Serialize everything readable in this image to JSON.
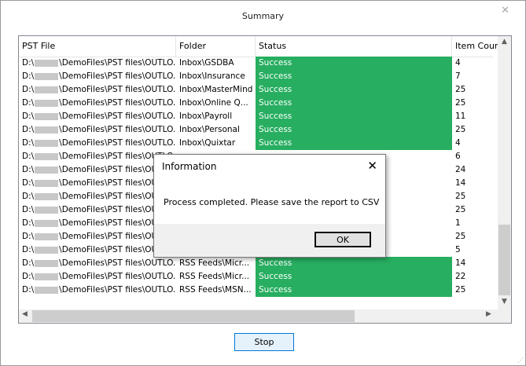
{
  "window": {
    "title": "Summary",
    "close_glyph": "✕"
  },
  "grid": {
    "columns": [
      "PST File",
      "Folder",
      "Status",
      "Item Count"
    ],
    "path_prefix": "D:\\",
    "path_suffix": "\\DemoFiles\\PST files\\OUTLO...",
    "rows": [
      {
        "folder": "Inbox\\GSDBA",
        "status": "Success",
        "count": "4"
      },
      {
        "folder": "Inbox\\Insurance",
        "status": "Success",
        "count": "7"
      },
      {
        "folder": "Inbox\\MasterMind",
        "status": "Success",
        "count": "25"
      },
      {
        "folder": "Inbox\\Online Q...",
        "status": "Success",
        "count": "25"
      },
      {
        "folder": "Inbox\\Payroll",
        "status": "Success",
        "count": "11"
      },
      {
        "folder": "Inbox\\Personal",
        "status": "Success",
        "count": "25"
      },
      {
        "folder": "Inbox\\Quixtar",
        "status": "Success",
        "count": "4"
      },
      {
        "folder": "",
        "status": "",
        "count": "6"
      },
      {
        "folder": "",
        "status": "",
        "count": "24"
      },
      {
        "folder": "",
        "status": "",
        "count": "14"
      },
      {
        "folder": "",
        "status": "",
        "count": "25"
      },
      {
        "folder": "",
        "status": "",
        "count": "25"
      },
      {
        "folder": "",
        "status": "",
        "count": "1"
      },
      {
        "folder": "",
        "status": "",
        "count": "25"
      },
      {
        "folder": "",
        "status": "",
        "count": "5"
      },
      {
        "folder": "RSS Feeds\\Micr...",
        "status": "Success",
        "count": "14"
      },
      {
        "folder": "RSS Feeds\\Micr...",
        "status": "Success",
        "count": "22"
      },
      {
        "folder": "RSS Feeds\\MSN...",
        "status": "Success",
        "count": "25"
      }
    ],
    "status_color": "#27ae60"
  },
  "dialog": {
    "title": "Information",
    "message": "Process completed. Please save the report to CSV",
    "ok_label": "OK",
    "close_glyph": "✕"
  },
  "buttons": {
    "stop_label": "Stop"
  },
  "icons": {
    "scroll_up": "▲",
    "scroll_down": "▼",
    "scroll_left": "◀",
    "scroll_right": "▶"
  }
}
